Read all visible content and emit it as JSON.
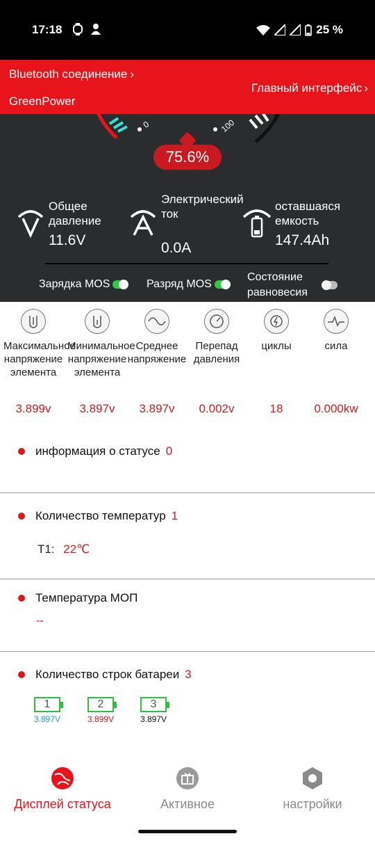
{
  "status_bar": {
    "time": "17:18",
    "battery": "25 %"
  },
  "header": {
    "bluetooth_label": "Bluetooth соединение",
    "device_name": "GreenPower",
    "main_interface_label": "Главный интерфейс"
  },
  "gauge": {
    "min_label": "0",
    "max_label": "100",
    "soc": "75.6%",
    "soc_fraction": 0.756
  },
  "metrics": {
    "voltage": {
      "label": "Общее давление",
      "value": "11.6V"
    },
    "current": {
      "label": "Электрический ток",
      "value": "0.0A"
    },
    "capacity": {
      "label": "оставшаяся емкость",
      "value": "147.4Ah"
    }
  },
  "toggles": {
    "charge_mos": {
      "label": "Зарядка MOS",
      "state": "on"
    },
    "discharge_mos": {
      "label": "Разряд MOS",
      "state": "on"
    },
    "balance": {
      "label": "Состояние равновесия",
      "state": "off"
    }
  },
  "stats": [
    {
      "icon": "max-cell-icon",
      "label": "Максимальное напряжение элемента",
      "value": "3.899v"
    },
    {
      "icon": "min-cell-icon",
      "label": "Минимальное напряжение элемента",
      "value": "3.897v"
    },
    {
      "icon": "avg-voltage-icon",
      "label": "Среднее напряжение",
      "value": "3.897v"
    },
    {
      "icon": "gauge-icon",
      "label": "Перепад давления",
      "value": "0.002v"
    },
    {
      "icon": "cycles-icon",
      "label": "циклы",
      "value": "18"
    },
    {
      "icon": "power-icon",
      "label": "сила",
      "value": "0.000kw"
    }
  ],
  "status_info": {
    "title": "информация о статусе",
    "count": "0"
  },
  "temperatures": {
    "title": "Количество температур",
    "count": "1",
    "items": [
      {
        "name": "T1:",
        "value": "22℃"
      }
    ]
  },
  "mos_temp": {
    "title": "Температура МОП",
    "value": "--"
  },
  "cells": {
    "title": "Количество строк батареи",
    "count": "3",
    "items": [
      {
        "index": "1",
        "voltage": "3.897V",
        "color": "#1aa0e0"
      },
      {
        "index": "2",
        "voltage": "3.899V",
        "color": "#d8191f"
      },
      {
        "index": "3",
        "voltage": "3.897V",
        "color": "#111111"
      }
    ]
  },
  "nav": [
    {
      "label": "Дисплей статуса",
      "icon": "status-display-icon",
      "active": true
    },
    {
      "label": "Активное",
      "icon": "active-icon",
      "active": false
    },
    {
      "label": "настройки",
      "icon": "settings-icon",
      "active": false
    }
  ],
  "colors": {
    "accent": "#e8141c",
    "panel": "#2b2c2e",
    "value_red": "#d8191f",
    "toggle_on": "#2ecc40",
    "cell_green": "#2ec23a"
  }
}
